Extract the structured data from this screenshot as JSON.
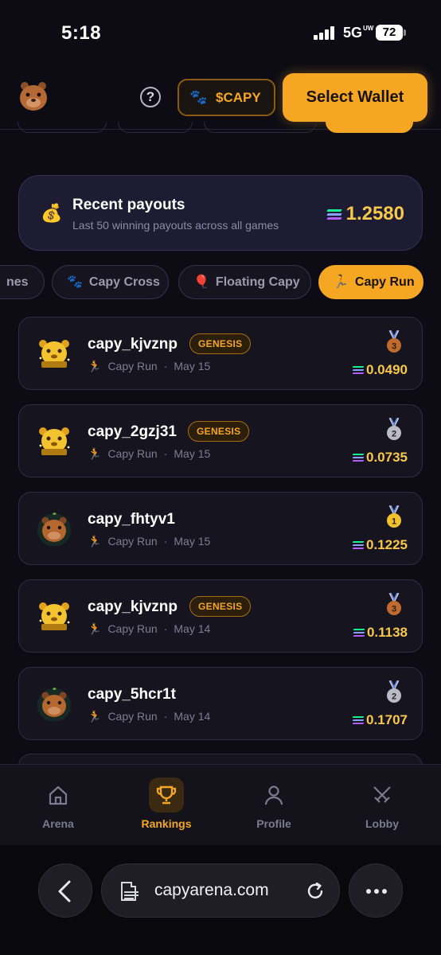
{
  "status_bar": {
    "time": "5:18",
    "network": "5G",
    "network_sup": "UW",
    "battery": "72"
  },
  "header": {
    "token_label": "$CAPY",
    "wallet_label": "Select Wallet",
    "help_label": "?"
  },
  "payout_summary": {
    "title": "Recent payouts",
    "subtitle": "Last 50 winning payouts across all games",
    "total": "1.2580"
  },
  "tabs": [
    {
      "label": "nes",
      "icon": "game-icon",
      "active": false
    },
    {
      "label": "Capy Cross",
      "icon": "paw-icon",
      "active": false
    },
    {
      "label": "Floating Capy",
      "icon": "balloon-icon",
      "active": false
    },
    {
      "label": "Capy Run",
      "icon": "runner-icon",
      "active": true
    }
  ],
  "payouts": [
    {
      "name": "capy_kjvznp",
      "badge": "GENESIS",
      "game": "Capy Run",
      "date": "May 15",
      "rank": "3",
      "amount": "0.0490",
      "avatar": "genesis-avatar"
    },
    {
      "name": "capy_2gzj31",
      "badge": "GENESIS",
      "game": "Capy Run",
      "date": "May 15",
      "rank": "2",
      "amount": "0.0735",
      "avatar": "genesis-avatar"
    },
    {
      "name": "capy_fhtyv1",
      "badge": "",
      "game": "Capy Run",
      "date": "May 15",
      "rank": "1",
      "amount": "0.1225",
      "avatar": "capybara-avatar"
    },
    {
      "name": "capy_kjvznp",
      "badge": "GENESIS",
      "game": "Capy Run",
      "date": "May 14",
      "rank": "3",
      "amount": "0.1138",
      "avatar": "genesis-avatar"
    },
    {
      "name": "capy_5hcr1t",
      "badge": "",
      "game": "Capy Run",
      "date": "May 14",
      "rank": "2",
      "amount": "0.1707",
      "avatar": "capybara-avatar"
    }
  ],
  "bottom_nav": [
    {
      "label": "Arena",
      "icon": "home-icon",
      "active": false
    },
    {
      "label": "Rankings",
      "icon": "trophy-icon",
      "active": true
    },
    {
      "label": "Profile",
      "icon": "user-icon",
      "active": false
    },
    {
      "label": "Lobby",
      "icon": "swords-icon",
      "active": false
    }
  ],
  "browser": {
    "url": "capyarena.com"
  },
  "colors": {
    "accent": "#f5a623",
    "background": "#0d0c14",
    "amount": "#f7c84b",
    "gold": "#f2c12e",
    "silver": "#b8bcc8",
    "bronze": "#c06a2d"
  }
}
